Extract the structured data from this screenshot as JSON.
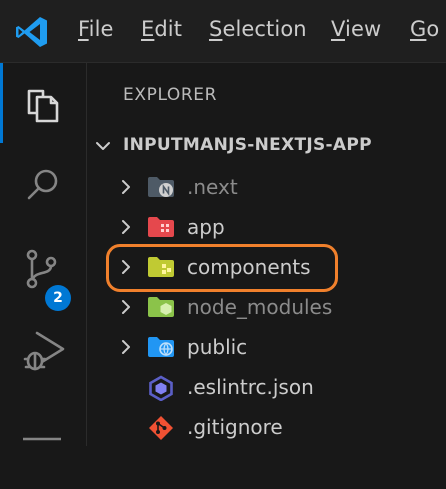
{
  "menu": {
    "items": [
      {
        "mnemonic": "F",
        "rest": "ile"
      },
      {
        "mnemonic": "E",
        "rest": "dit"
      },
      {
        "mnemonic": "S",
        "rest": "election"
      },
      {
        "mnemonic": "V",
        "rest": "iew"
      },
      {
        "mnemonic": "G",
        "rest": "o"
      }
    ]
  },
  "activity_bar": {
    "items": [
      {
        "icon": "files-icon",
        "active": true
      },
      {
        "icon": "search-icon"
      },
      {
        "icon": "source-control-icon",
        "badge": "2"
      },
      {
        "icon": "run-debug-icon"
      },
      {
        "icon": "extensions-icon"
      }
    ]
  },
  "explorer": {
    "title": "EXPLORER",
    "project": "INPUTMANJS-NEXTJS-APP",
    "entries": [
      {
        "label": ".next",
        "type": "folder",
        "icon": "next-folder-icon",
        "dimmed": true
      },
      {
        "label": "app",
        "type": "folder",
        "icon": "app-folder-icon"
      },
      {
        "label": "components",
        "type": "folder",
        "icon": "components-folder-icon",
        "highlighted": true
      },
      {
        "label": "node_modules",
        "type": "folder",
        "icon": "node-modules-folder-icon",
        "dimmed": true
      },
      {
        "label": "public",
        "type": "folder",
        "icon": "public-folder-icon"
      },
      {
        "label": ".eslintrc.json",
        "type": "file",
        "icon": "eslint-icon"
      },
      {
        "label": ".gitignore",
        "type": "file",
        "icon": "git-icon"
      }
    ]
  },
  "colors": {
    "accent": "#0078d4",
    "highlight_ring": "#f0802c"
  }
}
